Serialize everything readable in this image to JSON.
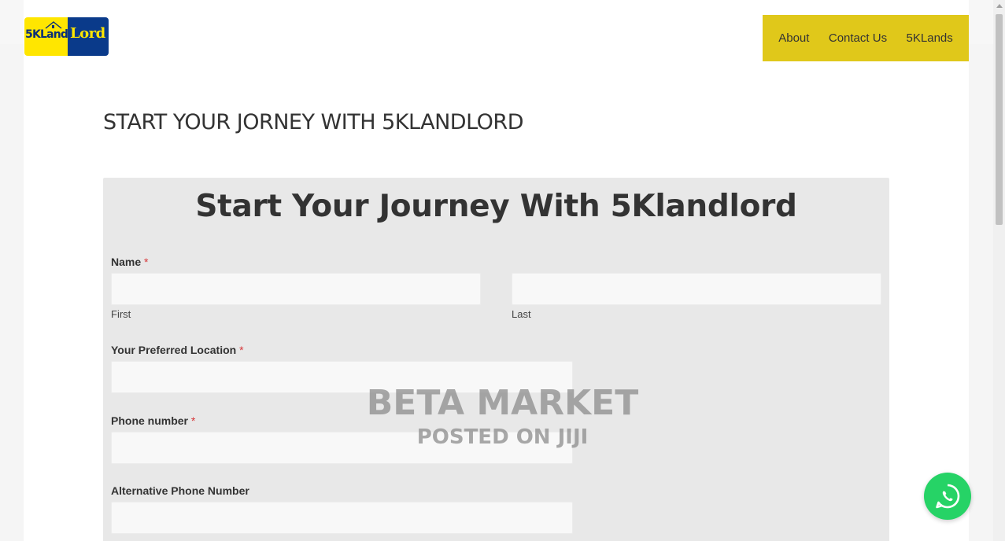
{
  "logo": {
    "part1": "5KLand",
    "part2": "Lord"
  },
  "nav": {
    "items": [
      "About",
      "Contact Us",
      "5KLands"
    ]
  },
  "page": {
    "heading": "START YOUR JORNEY WITH 5KLANDLORD"
  },
  "form": {
    "title": "Start Your Journey With 5Klandlord",
    "required_mark": "*",
    "name_label": "Name",
    "first_sub": "First",
    "last_sub": "Last",
    "first_value": "",
    "last_value": "",
    "location_label": "Your Preferred Location",
    "location_value": "",
    "phone_label": "Phone number",
    "phone_value": "",
    "alt_phone_label": "Alternative Phone Number",
    "alt_phone_value": ""
  },
  "watermark": {
    "line1": "BETA MARKET",
    "line2": "POSTED ON JIJI"
  },
  "colors": {
    "nav_bg": "#e0c81a",
    "whatsapp": "#26d366",
    "logo_yellow": "#ffe600",
    "logo_blue": "#0a3a8a"
  },
  "icons": {
    "chat": "whatsapp-icon"
  }
}
